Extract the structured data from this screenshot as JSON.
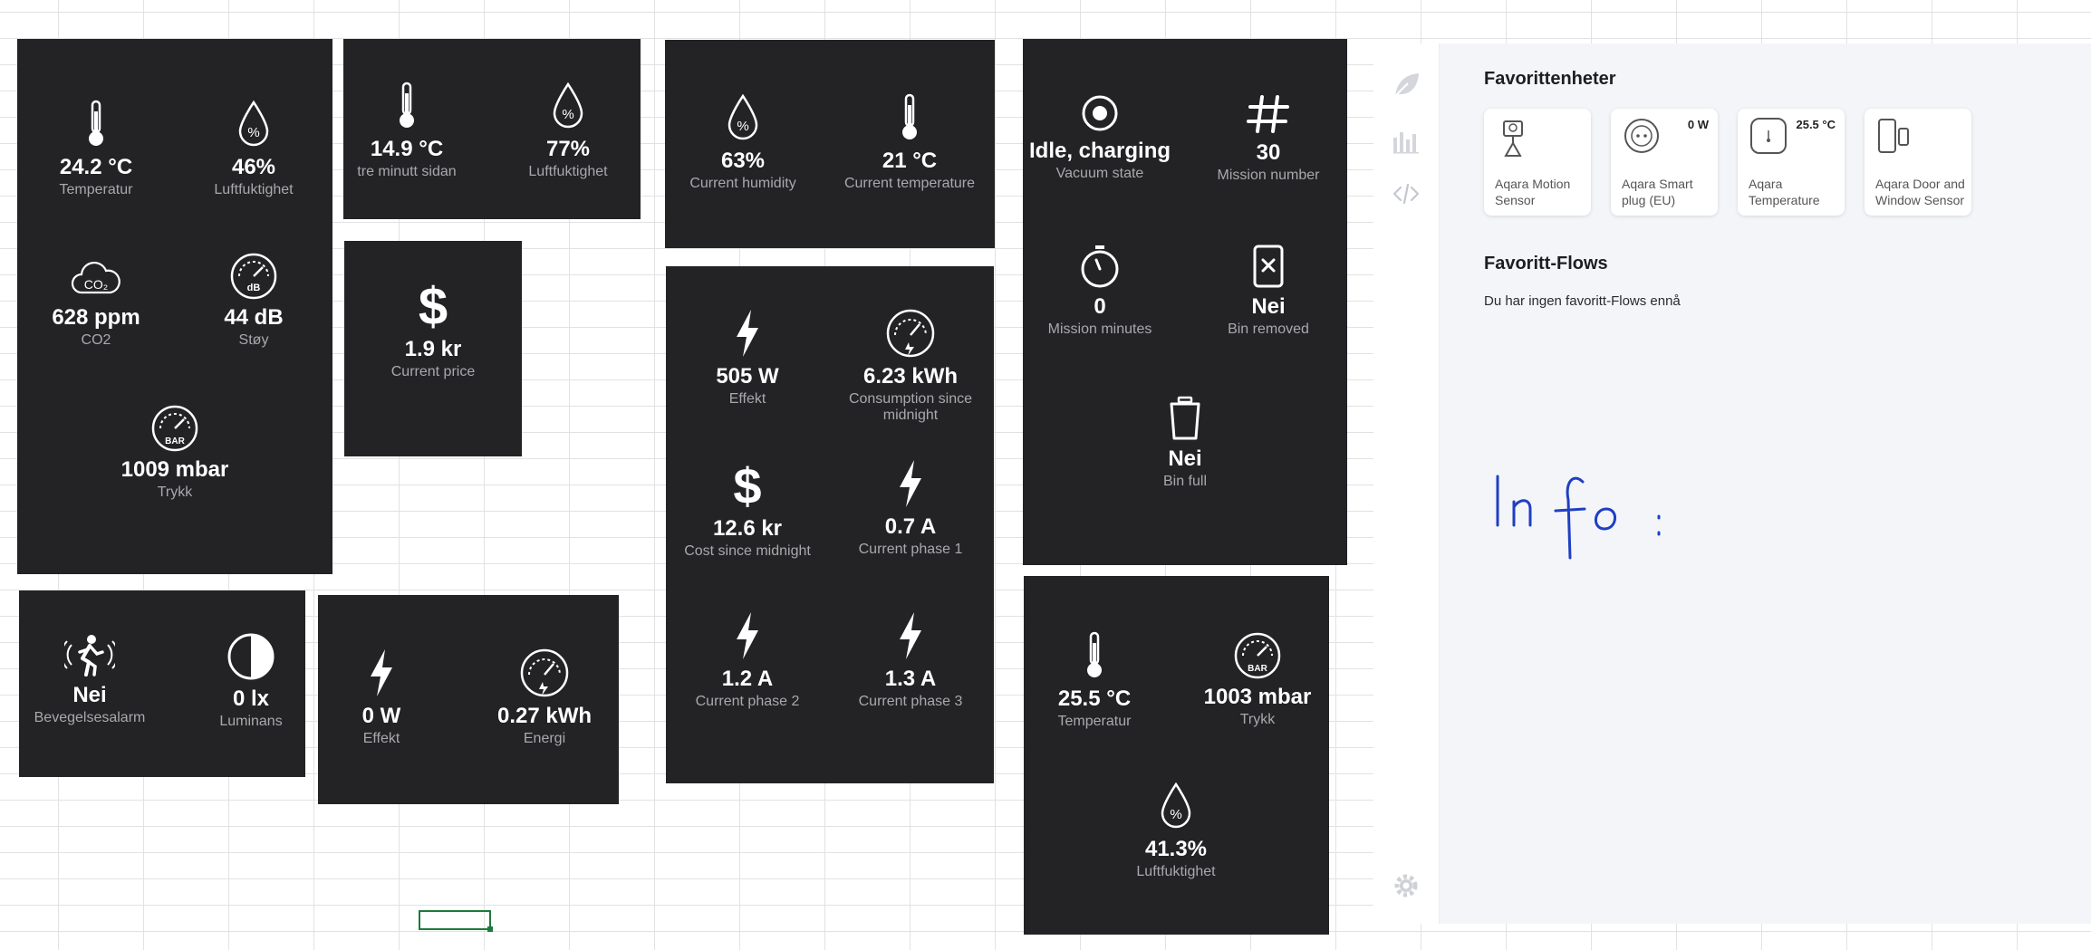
{
  "panels": {
    "climate_room": {
      "temperature": {
        "value": "24.2 °C",
        "label": "Temperatur",
        "icon": "thermometer-icon"
      },
      "humidity": {
        "value": "46%",
        "label": "Luftfuktighet",
        "icon": "humidity-drop-icon"
      },
      "co2": {
        "value": "628 ppm",
        "label": "CO2",
        "icon": "co2-cloud-icon"
      },
      "noise": {
        "value": "44 dB",
        "label": "Støy",
        "icon": "db-gauge-icon"
      },
      "pressure": {
        "value": "1009 mbar",
        "label": "Trykk",
        "icon": "bar-gauge-icon"
      }
    },
    "outdoor": {
      "temperature": {
        "value": "14.9 °C",
        "label": "tre minutt sidan",
        "icon": "thermometer-icon"
      },
      "humidity": {
        "value": "77%",
        "label": "Luftfuktighet",
        "icon": "humidity-drop-icon"
      }
    },
    "price": {
      "current_price": {
        "value": "1.9 kr",
        "label": "Current price",
        "icon": "dollar-icon"
      }
    },
    "humidity_temp": {
      "humidity": {
        "value": "63%",
        "label": "Current humidity",
        "icon": "humidity-drop-icon"
      },
      "temperature": {
        "value": "21 °C",
        "label": "Current temperature",
        "icon": "thermometer-icon"
      }
    },
    "power_meter": {
      "effect": {
        "value": "505 W",
        "label": "Effekt",
        "icon": "lightning-icon"
      },
      "consumption": {
        "value": "6.23 kWh",
        "label": "Consumption since midnight",
        "icon": "energy-gauge-icon"
      },
      "cost": {
        "value": "12.6 kr",
        "label": "Cost since midnight",
        "icon": "dollar-icon"
      },
      "phase1": {
        "value": "0.7 A",
        "label": "Current phase 1",
        "icon": "lightning-icon"
      },
      "phase2": {
        "value": "1.2 A",
        "label": "Current phase 2",
        "icon": "lightning-icon"
      },
      "phase3": {
        "value": "1.3 A",
        "label": "Current phase 3",
        "icon": "lightning-icon"
      }
    },
    "vacuum": {
      "state": {
        "value": "Idle, charging",
        "label": "Vacuum state",
        "icon": "target-icon"
      },
      "mission_number": {
        "value": "30",
        "label": "Mission number",
        "icon": "hashtag-icon"
      },
      "mission_minutes": {
        "value": "0",
        "label": "Mission minutes",
        "icon": "stopwatch-icon"
      },
      "bin_removed": {
        "value": "Nei",
        "label": "Bin removed",
        "icon": "bin-removed-icon"
      },
      "bin_full": {
        "value": "Nei",
        "label": "Bin full",
        "icon": "bin-icon"
      }
    },
    "motion": {
      "alarm": {
        "value": "Nei",
        "label": "Bevegelsesalarm",
        "icon": "motion-icon"
      },
      "luminance": {
        "value": "0 lx",
        "label": "Luminans",
        "icon": "luminance-icon"
      }
    },
    "plug": {
      "effect": {
        "value": "0 W",
        "label": "Effekt",
        "icon": "lightning-icon"
      },
      "energy": {
        "value": "0.27 kWh",
        "label": "Energi",
        "icon": "energy-gauge-icon"
      }
    },
    "sensor2": {
      "temperature": {
        "value": "25.5 °C",
        "label": "Temperatur",
        "icon": "thermometer-icon"
      },
      "pressure": {
        "value": "1003 mbar",
        "label": "Trykk",
        "icon": "bar-gauge-icon"
      },
      "humidity": {
        "value": "41.3%",
        "label": "Luftfuktighet",
        "icon": "humidity-drop-icon"
      }
    }
  },
  "app": {
    "favorites_devices_title": "Favorittenheter",
    "devices": [
      {
        "name": "Aqara Motion Sensor",
        "value": "",
        "icon": "motion-sensor-icon"
      },
      {
        "name": "Aqara Smart plug (EU)",
        "value": "0 W",
        "icon": "smart-plug-icon"
      },
      {
        "name": "Aqara Temperature",
        "value": "25.5 °C",
        "icon": "temperature-sensor-icon"
      },
      {
        "name": "Aqara Door and Window Sensor",
        "value": "",
        "icon": "door-sensor-icon"
      }
    ],
    "favorites_flows_title": "Favoritt-Flows",
    "flows_empty": "Du har ingen favoritt-Flows ennå",
    "handwritten_note": "Info:"
  },
  "rail": {
    "icons": [
      "leaf-icon",
      "insights-icon",
      "code-icon",
      "settings-icon"
    ]
  },
  "colors": {
    "panel_bg": "#232326",
    "label_gray": "#a9a9ad",
    "app_bg": "#f4f5f8",
    "ink_blue": "#1f3fc4",
    "selection_green": "#1e7a3a"
  }
}
